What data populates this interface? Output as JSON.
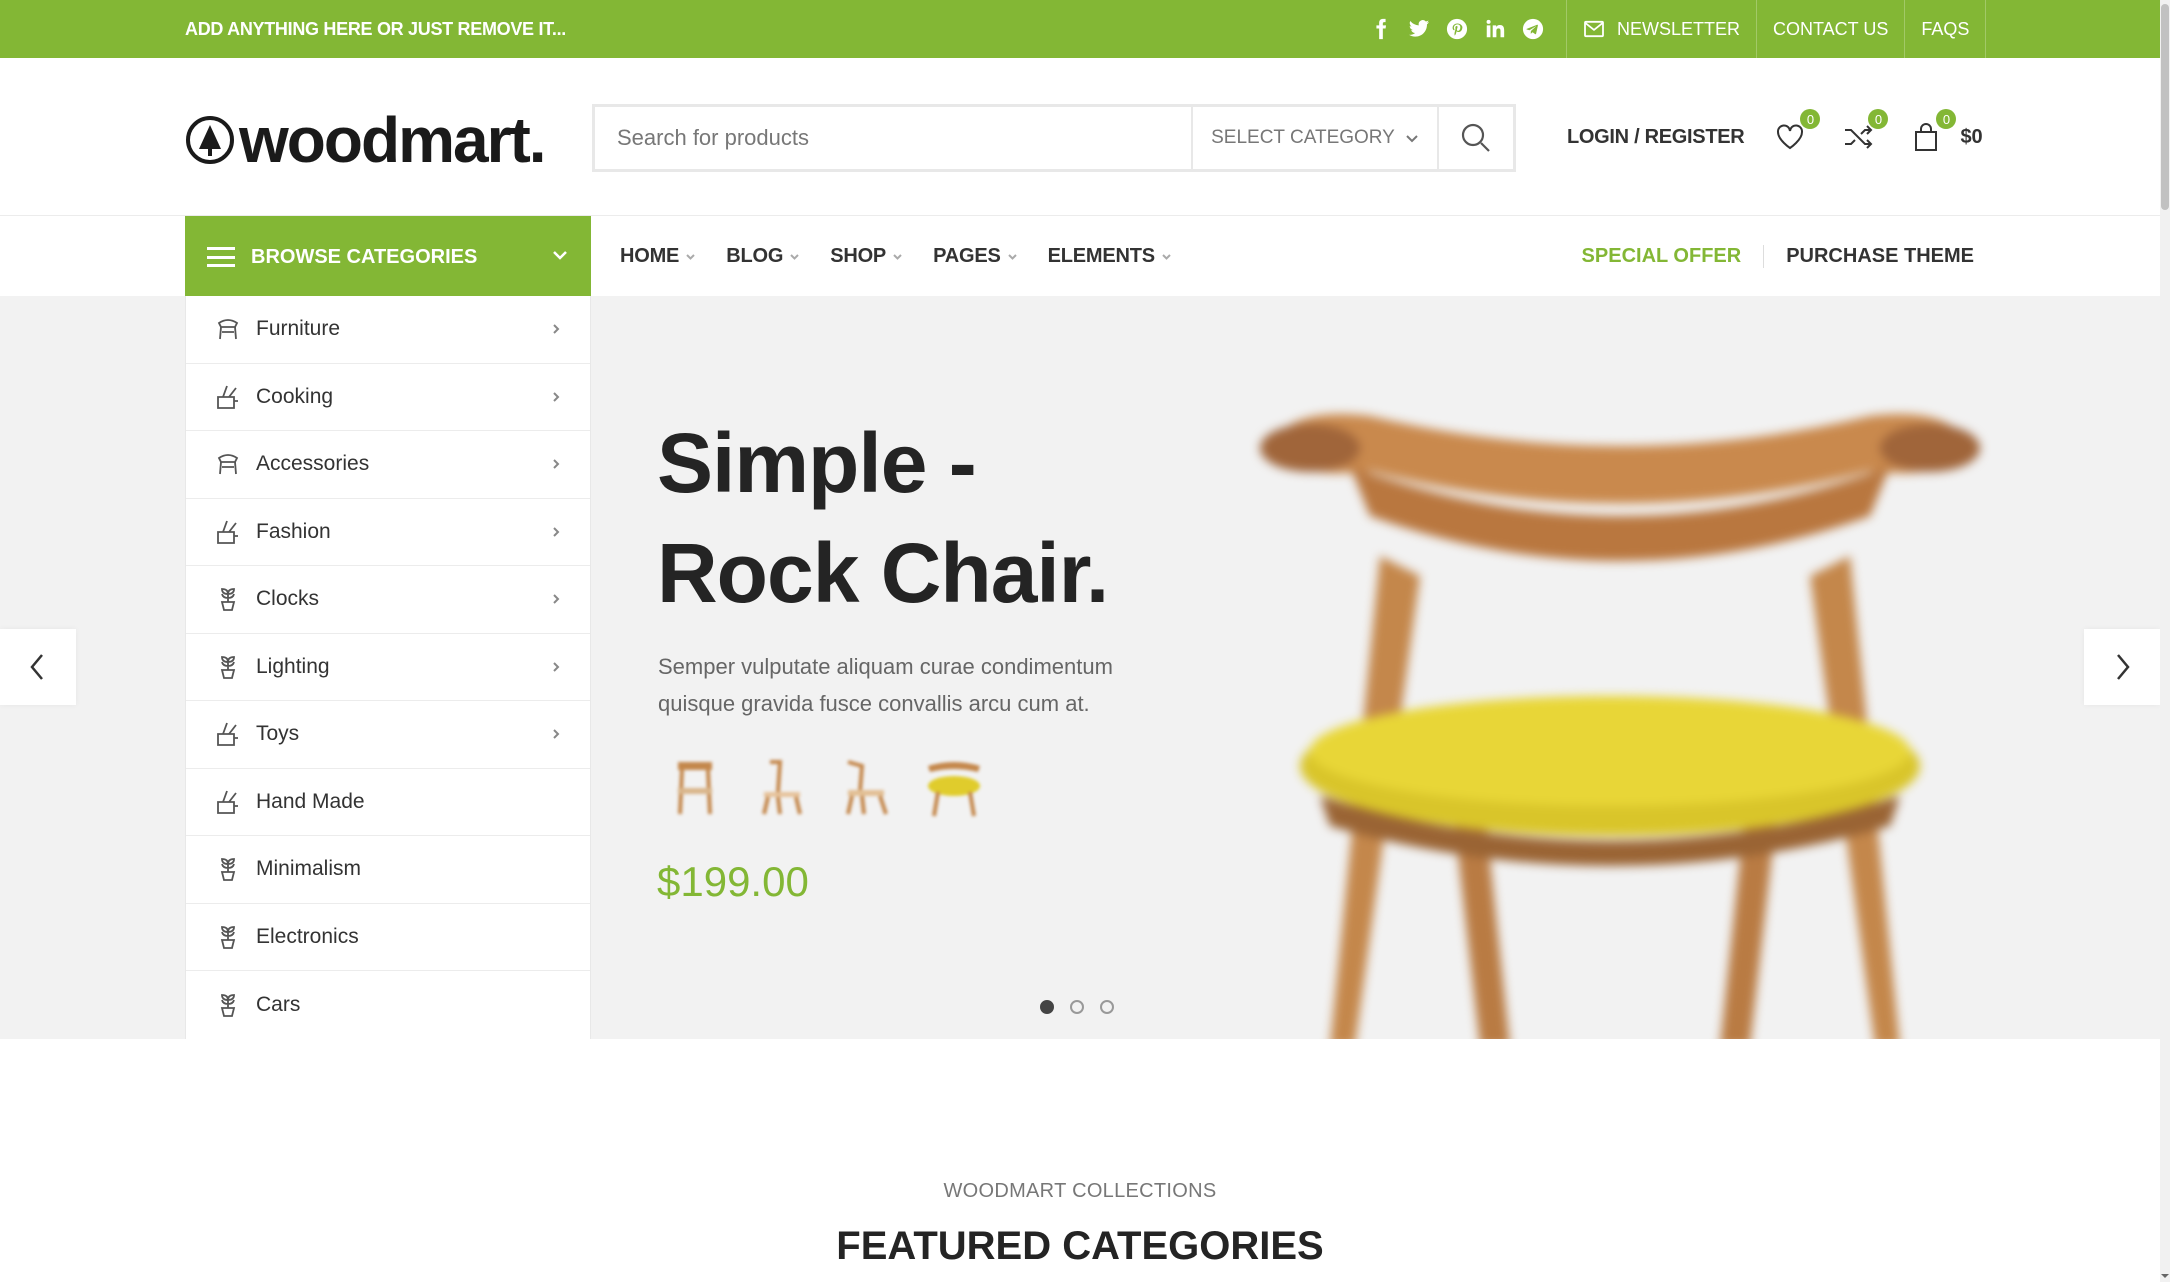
{
  "topbar": {
    "promo": "ADD ANYTHING HERE OR JUST REMOVE IT...",
    "social": [
      "facebook-icon",
      "twitter-icon",
      "pinterest-icon",
      "linkedin-icon",
      "telegram-icon"
    ],
    "links": {
      "newsletter": "NEWSLETTER",
      "contact": "CONTACT US",
      "faqs": "FAQS"
    },
    "bg_color": "#83b735"
  },
  "header": {
    "logo": "woodmart.",
    "search_placeholder": "Search for products",
    "select_category": "SELECT CATEGORY",
    "login": "LOGIN / REGISTER",
    "wishlist_count": "0",
    "compare_count": "0",
    "cart_count": "0",
    "cart_total": "$0"
  },
  "nav": {
    "browse": "BROWSE CATEGORIES",
    "menu": [
      "HOME",
      "BLOG",
      "SHOP",
      "PAGES",
      "ELEMENTS"
    ],
    "special_offer": "SPECIAL OFFER",
    "purchase": "PURCHASE THEME"
  },
  "categories": [
    {
      "label": "Furniture",
      "icon": "chair-icon",
      "arrow": true
    },
    {
      "label": "Cooking",
      "icon": "utensils-icon",
      "arrow": true
    },
    {
      "label": "Accessories",
      "icon": "chair-icon",
      "arrow": true
    },
    {
      "label": "Fashion",
      "icon": "utensils-icon",
      "arrow": true
    },
    {
      "label": "Clocks",
      "icon": "plant-icon",
      "arrow": true
    },
    {
      "label": "Lighting",
      "icon": "plant-icon",
      "arrow": true
    },
    {
      "label": "Toys",
      "icon": "utensils-icon",
      "arrow": true
    },
    {
      "label": "Hand Made",
      "icon": "utensils-icon",
      "arrow": false
    },
    {
      "label": "Minimalism",
      "icon": "plant-icon",
      "arrow": false
    },
    {
      "label": "Electronics",
      "icon": "plant-icon",
      "arrow": false
    },
    {
      "label": "Cars",
      "icon": "plant-icon",
      "arrow": false
    }
  ],
  "slide": {
    "title_line1": "Simple -",
    "title_line2": "Rock Chair.",
    "description": "Semper vulputate aliquam curae condimentum quisque gravida fusce convallis arcu cum at.",
    "price": "$199.00",
    "current_slide": 1,
    "slide_count": 3
  },
  "section": {
    "subtitle": "WOODMART COLLECTIONS",
    "title": "FEATURED CATEGORIES"
  }
}
